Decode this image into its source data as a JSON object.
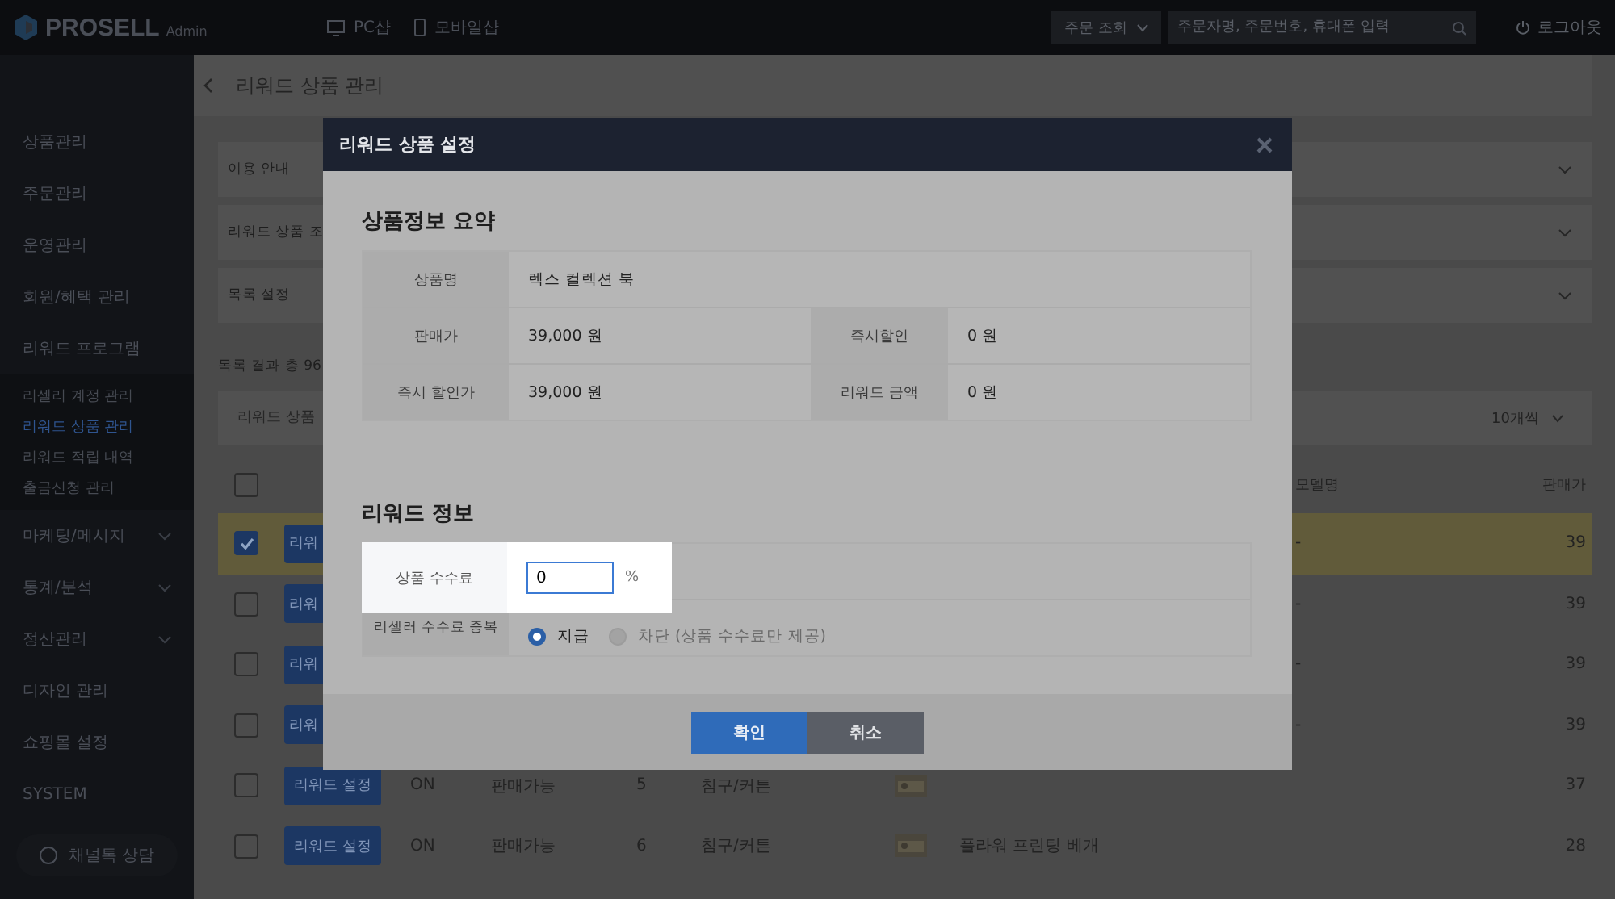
{
  "topbar": {
    "logo": "PROSELL",
    "logo_sub": "Admin",
    "links": [
      {
        "label": "PC샵",
        "kind": "pc"
      },
      {
        "label": "모바일샵",
        "kind": "mobile"
      }
    ],
    "order_select": "주문 조회",
    "search": {
      "placeholder": "주문자명, 주문번호, 휴대폰 입력"
    },
    "logout": "로그아웃"
  },
  "sidebar": {
    "items": [
      {
        "label": "상품관리",
        "selected": false
      },
      {
        "label": "주문관리",
        "selected": false
      },
      {
        "label": "운영관리",
        "selected": false
      },
      {
        "label": "회원/혜택 관리",
        "selected": false
      },
      {
        "label": "리워드 프로그램",
        "expanded": true,
        "selected": false,
        "children": [
          {
            "label": "리셀러 계정 관리",
            "selected": false
          },
          {
            "label": "리워드 상품 관리",
            "selected": true
          },
          {
            "label": "리워드 적립 내역",
            "selected": false
          },
          {
            "label": "출금신청 관리",
            "selected": false
          }
        ]
      },
      {
        "label": "마케팅/메시지",
        "expanded": false,
        "selected": false
      },
      {
        "label": "통계/분석",
        "expanded": false,
        "selected": false
      },
      {
        "label": "정산관리",
        "expanded": false,
        "selected": false
      },
      {
        "label": "디자인 관리",
        "selected": false
      },
      {
        "label": "쇼핑몰 설정",
        "selected": false
      },
      {
        "label": "SYSTEM",
        "selected": false
      }
    ],
    "chat_button": "채널톡 상담"
  },
  "page": {
    "title": "리워드 상품 관리",
    "panels": [
      {
        "label": "이용 안내"
      },
      {
        "label": "리워드 상품 조"
      },
      {
        "label": "목록 설정"
      }
    ],
    "results": "목록 결과 총 96",
    "search": {
      "placeholder": "리워드 상품"
    },
    "per_page": "10개씩",
    "all_checked": false,
    "columns": [
      "모델명",
      "판매가"
    ],
    "rows": [
      {
        "checked": true,
        "selected": true,
        "button": "리워",
        "model": "-",
        "price": "39"
      },
      {
        "checked": false,
        "selected": false,
        "button": "리워",
        "model": "-",
        "price": "39"
      },
      {
        "checked": false,
        "selected": false,
        "button": "리워",
        "model": "-",
        "price": "39"
      },
      {
        "checked": false,
        "selected": false,
        "button": "리워",
        "model": "-",
        "price": "39"
      },
      {
        "checked": false,
        "selected": false,
        "button": "리워드 설정",
        "status": "ON",
        "sale": "판매가능",
        "no": "5",
        "category": "침구/커튼",
        "thumbnail": true,
        "price": "37"
      },
      {
        "checked": false,
        "selected": false,
        "button": "리워드 설정",
        "status": "ON",
        "sale": "판매가능",
        "no": "6",
        "category": "침구/커튼",
        "thumbnail": true,
        "name": "플라워 프린팅 베개",
        "price": "28"
      }
    ]
  },
  "modal": {
    "title": "리워드 상품 설정",
    "summary": {
      "title": "상품정보 요약",
      "name_label": "상품명",
      "name": "렉스 컬렉션 북",
      "rows": [
        [
          {
            "label": "판매가",
            "value": "39,000 원"
          },
          {
            "label": "즉시할인",
            "value": "0 원"
          }
        ],
        [
          {
            "label": "즉시 할인가",
            "value": "39,000 원"
          },
          {
            "label": "리워드 금액",
            "value": "0 원"
          }
        ]
      ]
    },
    "reward": {
      "title": "리워드 정보",
      "fee_label": "상품 수수료",
      "fee_value": "0",
      "fee_unit": "%",
      "highlighted": true,
      "dup_label": "리셀러 수수료 중복",
      "options": [
        {
          "label": "지급",
          "selected": true
        },
        {
          "label": "차단 (상품 수수료만 제공)",
          "selected": false
        }
      ]
    },
    "buttons": [
      {
        "label": "확인",
        "kind": "primary"
      },
      {
        "label": "취소",
        "kind": "secondary"
      }
    ]
  }
}
